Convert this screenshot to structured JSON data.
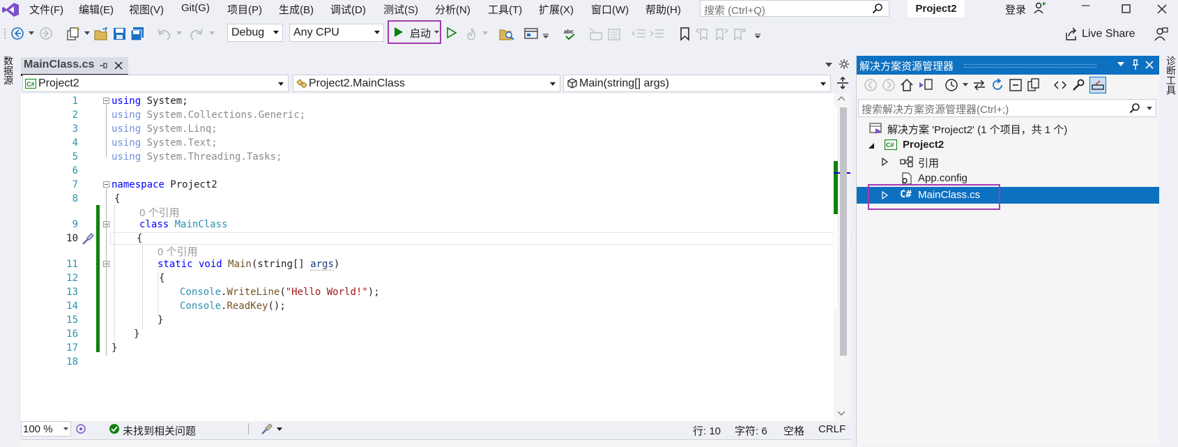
{
  "menu": {
    "items": [
      "文件(F)",
      "编辑(E)",
      "视图(V)",
      "Git(G)",
      "项目(P)",
      "生成(B)",
      "调试(D)",
      "测试(S)",
      "分析(N)",
      "工具(T)",
      "扩展(X)",
      "窗口(W)",
      "帮助(H)"
    ],
    "search_placeholder": "搜索 (Ctrl+Q)",
    "project_title": "Project2",
    "login": "登录"
  },
  "toolbar": {
    "config": "Debug",
    "platform": "Any CPU",
    "start_label": "启动",
    "live_share": "Live Share"
  },
  "sidebars": {
    "left": "数据源",
    "right": "诊断工具"
  },
  "editor": {
    "tab_label": "MainClass.cs",
    "nav_project": "Project2",
    "nav_class": "Project2.MainClass",
    "nav_member": "Main(string[] args)",
    "line_numbers": [
      "1",
      "2",
      "3",
      "4",
      "5",
      "6",
      "7",
      "8",
      "9",
      "10",
      "11",
      "12",
      "13",
      "14",
      "15",
      "16",
      "17",
      "18"
    ],
    "ref_count": "0 个引用",
    "code": {
      "l1_kw": "using",
      "l1_rest": " System;",
      "l2_kw": "using",
      "l2_rest": " System.Collections.Generic;",
      "l3_kw": "using",
      "l3_rest": " System.Linq;",
      "l4_kw": "using",
      "l4_rest": " System.Text;",
      "l5_kw": "using",
      "l5_rest": " System.Threading.Tasks;",
      "l7_kw": "namespace",
      "l7_rest": " Project2",
      "l8": "{",
      "l9_kw": "class",
      "l9_name": " MainClass",
      "l10": "{",
      "l11_kw": "static void",
      "l11_name": " Main",
      "l11_a": "(string[] ",
      "l11_param": "args",
      "l11_b": ")",
      "l12": "{",
      "l13_cls": "Console",
      "l13_dot": ".",
      "l13_method": "WriteLine",
      "l13_open": "(",
      "l13_str": "\"Hello World!\"",
      "l13_close": ");",
      "l14_cls": "Console",
      "l14_dot": ".",
      "l14_method": "ReadKey",
      "l14_close": "();",
      "l15": "}",
      "l16": "}",
      "l17": "}"
    }
  },
  "statusbar": {
    "zoom": "100 %",
    "issues": "未找到相关问题",
    "line": "行: 10",
    "char": "字符: 6",
    "spacing": "空格",
    "eol": "CRLF"
  },
  "solution_explorer": {
    "title": "解决方案资源管理器",
    "search_placeholder": "搜索解决方案资源管理器(Ctrl+;)",
    "tree": {
      "solution": "解决方案 'Project2' (1 个项目，共 1 个)",
      "project": "Project2",
      "references": "引用",
      "appconfig": "App.config",
      "mainclass": "MainClass.cs"
    }
  },
  "colors": {
    "accent": "#0e70c0",
    "highlight": "#a23ab2",
    "change_bar": "#108010"
  }
}
